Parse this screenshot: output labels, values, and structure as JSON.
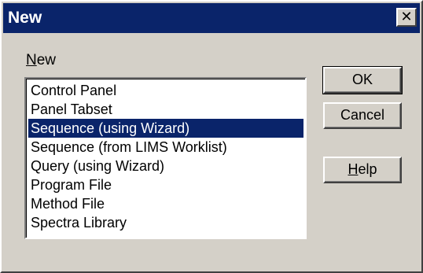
{
  "window": {
    "title": "New",
    "close_glyph": "✕"
  },
  "list": {
    "label_accel": "N",
    "label_rest": "ew",
    "items": [
      {
        "label": "Control Panel",
        "selected": false
      },
      {
        "label": "Panel Tabset",
        "selected": false
      },
      {
        "label": "Sequence (using Wizard)",
        "selected": true
      },
      {
        "label": "Sequence (from LIMS Worklist)",
        "selected": false
      },
      {
        "label": "Query (using Wizard)",
        "selected": false
      },
      {
        "label": "Program File",
        "selected": false
      },
      {
        "label": "Method File",
        "selected": false
      },
      {
        "label": "Spectra Library",
        "selected": false
      }
    ]
  },
  "buttons": {
    "ok": "OK",
    "cancel": "Cancel",
    "help_accel": "H",
    "help_rest": "elp"
  },
  "colors": {
    "titlebar": "#0a246a",
    "selection": "#0a246a",
    "face": "#d4d0c8"
  }
}
